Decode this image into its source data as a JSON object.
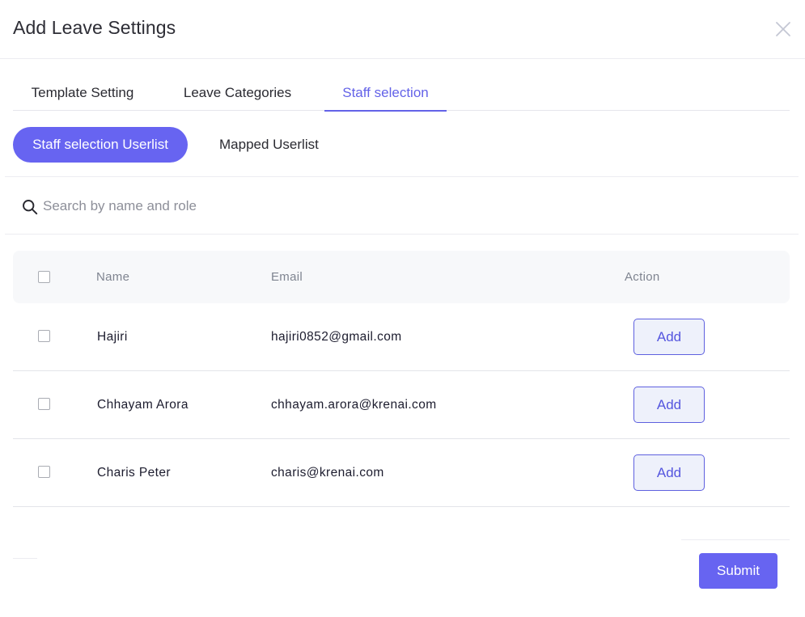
{
  "dialog": {
    "title": "Add Leave Settings",
    "close_icon": "close-icon"
  },
  "tabs": [
    {
      "label": "Template Setting",
      "active": false
    },
    {
      "label": "Leave Categories",
      "active": false
    },
    {
      "label": "Staff selection",
      "active": true
    }
  ],
  "subtabs": [
    {
      "label": "Staff selection Userlist",
      "active": true
    },
    {
      "label": "Mapped Userlist",
      "active": false
    }
  ],
  "search": {
    "icon": "search-icon",
    "placeholder": "Search by name and role",
    "value": ""
  },
  "table": {
    "headers": {
      "name": "Name",
      "email": "Email",
      "action": "Action"
    },
    "rows": [
      {
        "name": "Hajiri",
        "email": "hajiri0852@gmail.com",
        "action": "Add",
        "checked": false
      },
      {
        "name": "Chhayam Arora",
        "email": "chhayam.arora@krenai.com",
        "action": "Add",
        "checked": false
      },
      {
        "name": "Charis Peter",
        "email": "charis@krenai.com",
        "action": "Add",
        "checked": false
      }
    ]
  },
  "footer": {
    "submit_label": "Submit"
  },
  "colors": {
    "accent": "#6764f1",
    "tab_active": "#6362e8",
    "add_button_bg": "#eef1fb"
  }
}
